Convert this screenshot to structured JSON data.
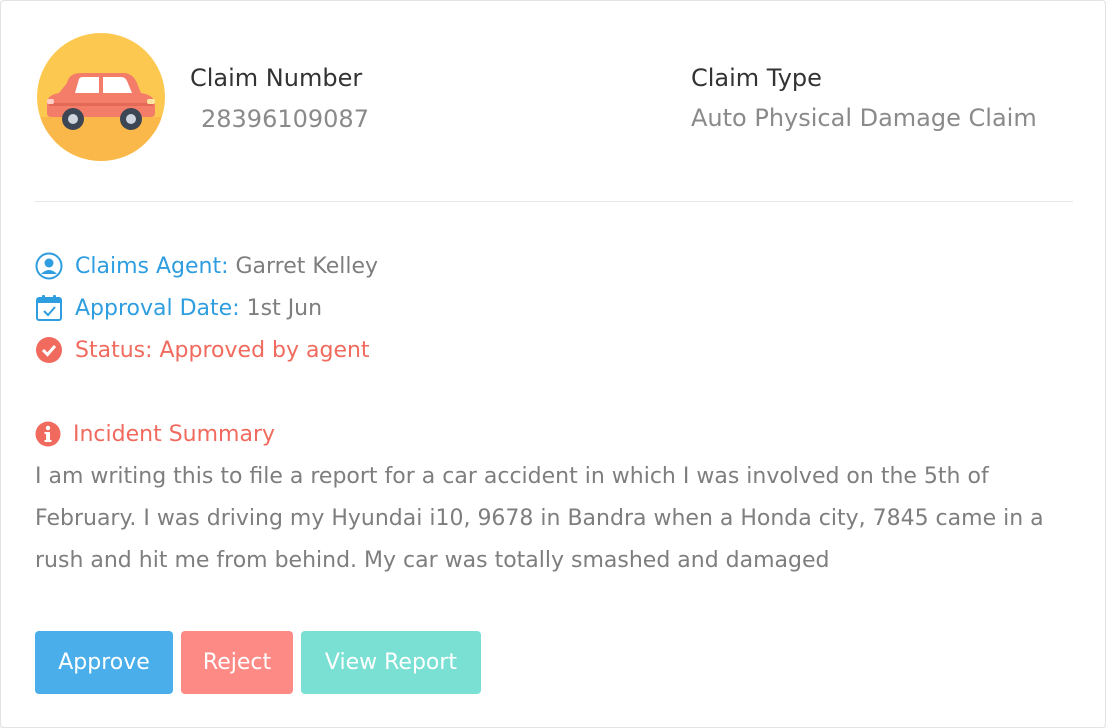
{
  "claim": {
    "number_label": "Claim Number",
    "number_value": "28396109087",
    "type_label": "Claim Type",
    "type_value": "Auto Physical Damage Claim",
    "avatar_icon": "car-icon"
  },
  "details": {
    "agent_label": "Claims Agent:",
    "agent_value": "Garret Kelley",
    "agent_icon": "user-circle-icon",
    "date_label": "Approval Date:",
    "date_value": "1st Jun",
    "date_icon": "calendar-check-icon",
    "status_text": "Status: Approved by agent",
    "status_icon": "check-circle-icon"
  },
  "summary": {
    "title": "Incident Summary",
    "icon": "info-circle-icon",
    "text": "I am writing this to file a report for a car accident in which I was involved on the 5th of February. I was driving my Hyundai i10, 9678 in Bandra when a Honda city, 7845 came in a rush and hit me from behind. My car was totally smashed and damaged"
  },
  "actions": {
    "approve_label": "Approve",
    "reject_label": "Reject",
    "report_label": "View Report"
  },
  "colors": {
    "accent_blue": "#2f9ee0",
    "accent_red": "#f06a5e",
    "approve": "#4aaeea",
    "reject": "#fd8a84",
    "report": "#79e0d3",
    "avatar_bg": "#fcc84f"
  }
}
